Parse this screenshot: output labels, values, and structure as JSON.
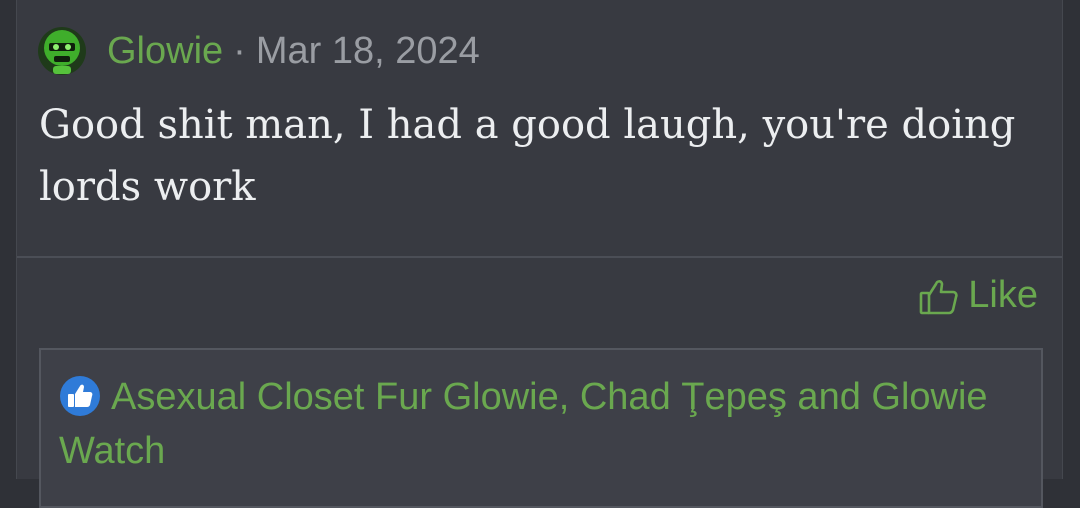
{
  "post": {
    "username": "Glowie",
    "separator": "·",
    "date": "Mar 18, 2024",
    "message": "Good shit man, I had a good laugh, you're doing lords work"
  },
  "actions": {
    "like_label": "Like"
  },
  "reactions": {
    "users": [
      "Asexual Closet Fur Glowie",
      "Chad Ţepeş",
      "Glowie Watch"
    ],
    "sep1": ", ",
    "sep2": " and ",
    "icon": "thumbs-up-icon"
  },
  "colors": {
    "accent": "#6aa84f",
    "text": "#eceef0",
    "muted": "#9a9da3",
    "reaction_icon": "#2f7bd8"
  }
}
